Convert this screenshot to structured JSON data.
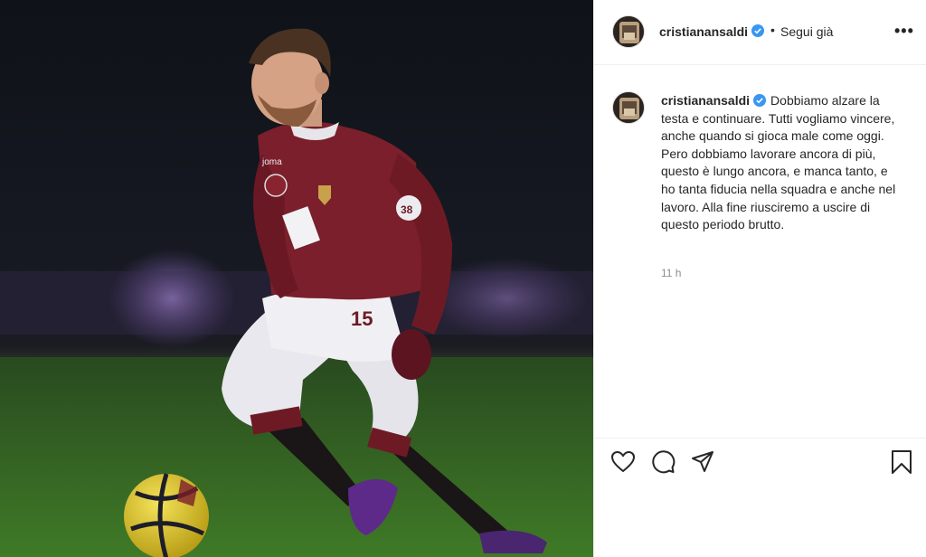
{
  "post": {
    "username": "cristianansaldi",
    "separator": "•",
    "follow_status": "Segui già",
    "more_label": "•••",
    "caption": "Dobbiamo alzare la testa e continuare. Tutti vogliamo vincere, anche quando si gioca male come oggi. Pero dobbiamo lavorare ancora di più, questo è lungo ancora, e manca tanto, e ho tanta fiducia nella squadra e anche nel lavoro. Alla fine riusciremo a uscire di questo periodo brutto.",
    "time_ago": "11 h"
  },
  "photo": {
    "shirt_number": "15",
    "shirt_badge_number": "38",
    "kit_brand": "joma"
  },
  "icons": {
    "like": "heart-icon",
    "comment": "comment-icon",
    "share": "send-icon",
    "save": "bookmark-icon",
    "verified": "verified-badge-icon",
    "more": "more-options-icon"
  },
  "colors": {
    "verified_blue": "#3897f0",
    "text": "#262626",
    "muted": "#8e8e8e",
    "border": "#efefef",
    "kit_maroon": "#7a1f2b"
  }
}
